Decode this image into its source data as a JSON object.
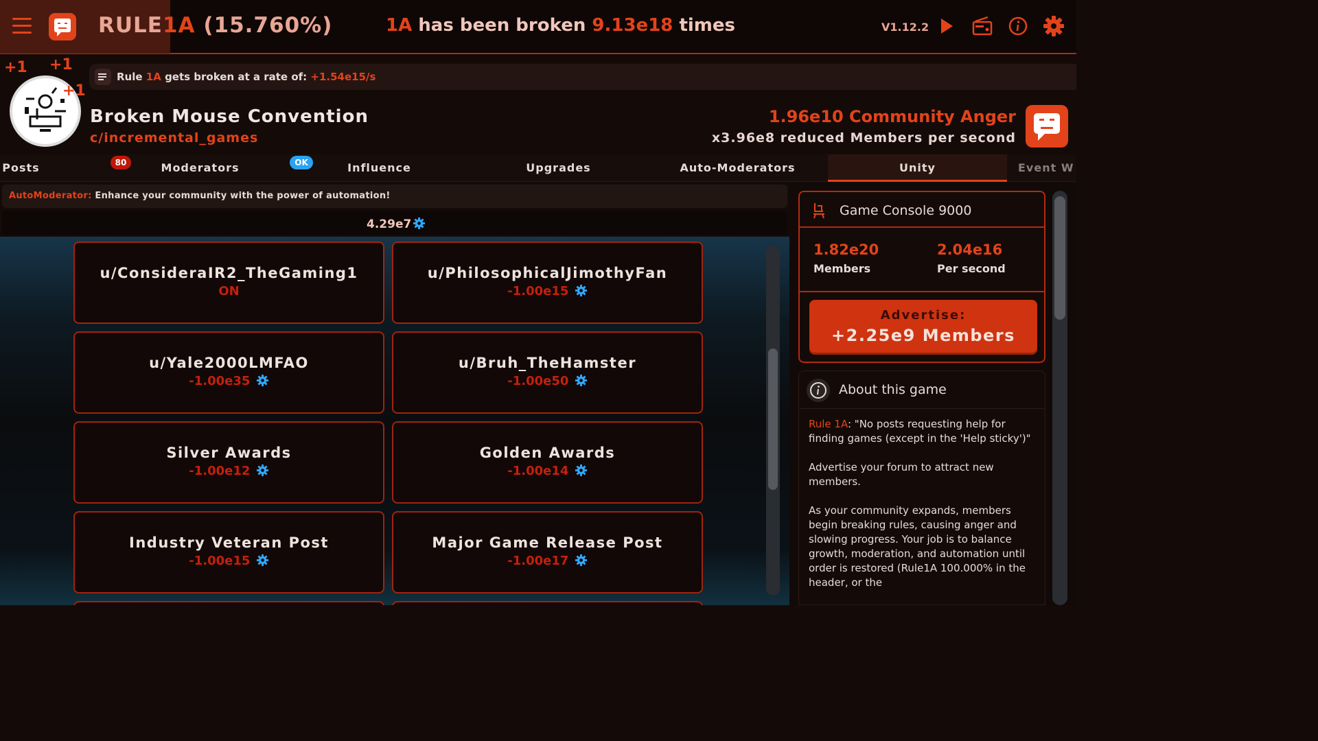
{
  "header": {
    "title_prefix": "RULE",
    "title_accent": "1A",
    "title_pct": "(15.760%)",
    "broken_accent": "1A",
    "broken_mid": "has been broken",
    "broken_count": "9.13e18",
    "broken_suffix": "times",
    "version": "V1.12.2"
  },
  "icons": {
    "menu": "hamburger-icon",
    "logo": "angry-face-icon",
    "play": "play-icon",
    "radio": "radio-icon",
    "info": "info-icon",
    "settings": "gear-icon"
  },
  "rate": {
    "prefix": "Rule",
    "accent": "1A",
    "mid": "gets broken at a rate of:",
    "value": "+1.54e15/s"
  },
  "floaters": [
    "+1",
    "+1",
    "+1"
  ],
  "community": {
    "name": "Broken Mouse Convention",
    "sub": "c/incremental_games",
    "anger": "1.96e10 Community Anger",
    "anger_effect": "x3.96e8 reduced Members per second"
  },
  "tabs": [
    {
      "label": "Posts"
    },
    {
      "label": "Moderators",
      "badge": "80"
    },
    {
      "label": "Influence",
      "badge": "OK"
    },
    {
      "label": "Upgrades"
    },
    {
      "label": "Auto-Moderators"
    },
    {
      "label": "Unity",
      "active": true
    },
    {
      "label": "Event W"
    }
  ],
  "automod": {
    "prefix": "AutoModerator:",
    "text": "Enhance your community with the power of automation!"
  },
  "currency": {
    "value": "4.29e7"
  },
  "cards": [
    {
      "title": "u/ConsideraIR2_TheGaming1",
      "cost": "ON",
      "gear": false
    },
    {
      "title": "u/PhilosophicalJimothyFan",
      "cost": "-1.00e15",
      "gear": true
    },
    {
      "title": "u/Yale2000LMFAO",
      "cost": "-1.00e35",
      "gear": true
    },
    {
      "title": "u/Bruh_TheHamster",
      "cost": "-1.00e50",
      "gear": true
    },
    {
      "title": "Silver Awards",
      "cost": "-1.00e12",
      "gear": true
    },
    {
      "title": "Golden Awards",
      "cost": "-1.00e14",
      "gear": true
    },
    {
      "title": "Industry Veteran Post",
      "cost": "-1.00e15",
      "gear": true
    },
    {
      "title": "Major Game Release Post",
      "cost": "-1.00e17",
      "gear": true
    }
  ],
  "console": {
    "title": "Game Console 9000",
    "members_value": "1.82e20",
    "members_label": "Members",
    "rate_value": "2.04e16",
    "rate_label": "Per second",
    "advertise_label": "Advertise:",
    "advertise_value": "+2.25e9 Members"
  },
  "about": {
    "title": "About this game",
    "p1_accent": "Rule 1A",
    "p1_text": ": \"No posts requesting help for finding games (except in the 'Help sticky')\"",
    "p2": "Advertise your forum to attract new members.",
    "p3": "As your community expands, members begin breaking rules, causing anger and slowing progress. Your job is to balance growth, moderation, and automation until order is restored (Rule1A 100.000% in the header, or the"
  },
  "colors": {
    "accent": "#e3431a",
    "dark_bg": "#140b09",
    "card_border": "#a1240f",
    "cost_red": "#c5200c",
    "gear_blue": "#2fa8ff",
    "badge_red": "#c0170a",
    "badge_blue": "#2aa3f5"
  }
}
